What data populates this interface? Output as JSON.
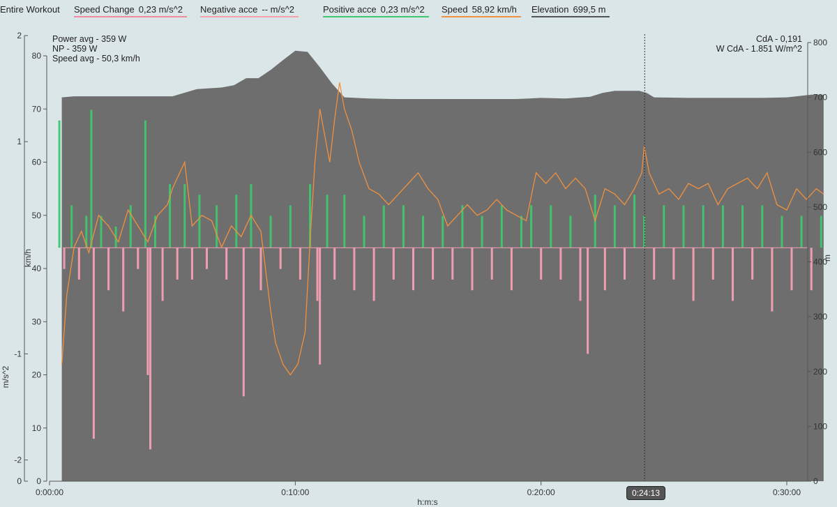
{
  "legend": {
    "scope": "Entire Workout",
    "items": [
      {
        "name": "Speed Change",
        "value": "0,23 m/s^2",
        "color": "#f08aa0"
      },
      {
        "name": "Negative acce",
        "value": "-- m/s^2",
        "color": "#f5a3a8"
      },
      {
        "name": "Positive acce",
        "value": "0,23 m/s^2",
        "color": "#3fc66e"
      },
      {
        "name": "Speed",
        "value": "58,92 km/h",
        "color": "#f0913f"
      },
      {
        "name": "Elevation",
        "value": "699,5 m",
        "color": "#555555"
      }
    ]
  },
  "info_left": [
    "Power avg - 359 W",
    "NP - 359 W",
    "Speed avg - 50,3 km/h"
  ],
  "info_right": [
    "CdA - 0,191",
    "W CdA - 1.851 W/m^2"
  ],
  "cursor_time": "0:24:13",
  "colors": {
    "background": "#dbe6e8",
    "elevation": "#6e6e6e",
    "speed": "#f0913f",
    "positive": "#3fc66e",
    "negative": "#f5a0b4"
  },
  "chart_data": {
    "type": "area",
    "xlabel": "h:m:s",
    "x_range_min": [
      0,
      31.5
    ],
    "x_ticks": [
      {
        "v": 0,
        "label": "0:00:00"
      },
      {
        "v": 10,
        "label": "0:10:00"
      },
      {
        "v": 20,
        "label": "0:20:00"
      },
      {
        "v": 30,
        "label": "0:30:00"
      }
    ],
    "axes": {
      "accel": {
        "label": "m/s^2",
        "range": [
          -2.2,
          2.0
        ],
        "ticks": [
          {
            "v": 2,
            "label": "2"
          },
          {
            "v": 1,
            "label": "1"
          },
          {
            "v": -1,
            "label": "-1"
          },
          {
            "v": -2,
            "label": "-2"
          },
          {
            "v": -2.2,
            "label": "0"
          }
        ]
      },
      "speed": {
        "label": "km/h",
        "range": [
          0,
          80
        ],
        "ticks": [
          0,
          10,
          20,
          30,
          40,
          50,
          60,
          70,
          80
        ]
      },
      "elevation": {
        "label": "m",
        "range": [
          0,
          800
        ],
        "ticks": [
          0,
          100,
          200,
          300,
          400,
          500,
          600,
          700,
          800
        ]
      }
    },
    "series": [
      {
        "name": "Elevation",
        "unit": "m",
        "points": [
          [
            0.5,
            700
          ],
          [
            1,
            702
          ],
          [
            2,
            702
          ],
          [
            3,
            702
          ],
          [
            4,
            702
          ],
          [
            5,
            702
          ],
          [
            6,
            715
          ],
          [
            7,
            718
          ],
          [
            7.5,
            722
          ],
          [
            8,
            735
          ],
          [
            8.5,
            735
          ],
          [
            9,
            750
          ],
          [
            9.5,
            768
          ],
          [
            10,
            785
          ],
          [
            10.5,
            783
          ],
          [
            11,
            755
          ],
          [
            11.5,
            725
          ],
          [
            12,
            700
          ],
          [
            13,
            698
          ],
          [
            14,
            697
          ],
          [
            15,
            697
          ],
          [
            16,
            697
          ],
          [
            17,
            697
          ],
          [
            18,
            697
          ],
          [
            19,
            697
          ],
          [
            19.5,
            698
          ],
          [
            20,
            699
          ],
          [
            21,
            698
          ],
          [
            22,
            701
          ],
          [
            22.5,
            708
          ],
          [
            23,
            712
          ],
          [
            24,
            712
          ],
          [
            24.3,
            708
          ],
          [
            24.6,
            700
          ],
          [
            26,
            699
          ],
          [
            28,
            699
          ],
          [
            29,
            699
          ],
          [
            30,
            700
          ],
          [
            31,
            705
          ],
          [
            31.5,
            705
          ]
        ]
      },
      {
        "name": "Speed",
        "unit": "km/h",
        "points": [
          [
            0.5,
            22
          ],
          [
            0.7,
            35
          ],
          [
            1,
            44
          ],
          [
            1.3,
            47
          ],
          [
            1.6,
            43
          ],
          [
            2,
            50
          ],
          [
            2.4,
            48
          ],
          [
            2.8,
            45
          ],
          [
            3.2,
            51
          ],
          [
            3.6,
            48
          ],
          [
            4,
            45
          ],
          [
            4.4,
            50
          ],
          [
            4.8,
            52
          ],
          [
            5,
            55
          ],
          [
            5.3,
            58
          ],
          [
            5.5,
            60
          ],
          [
            5.8,
            48
          ],
          [
            6.2,
            50
          ],
          [
            6.6,
            49
          ],
          [
            7,
            44
          ],
          [
            7.4,
            48
          ],
          [
            7.8,
            46
          ],
          [
            8.2,
            50
          ],
          [
            8.6,
            47
          ],
          [
            9,
            32
          ],
          [
            9.2,
            26
          ],
          [
            9.5,
            22
          ],
          [
            9.8,
            20
          ],
          [
            10.1,
            22
          ],
          [
            10.4,
            28
          ],
          [
            10.6,
            45
          ],
          [
            10.8,
            60
          ],
          [
            11,
            70
          ],
          [
            11.2,
            65
          ],
          [
            11.4,
            60
          ],
          [
            11.6,
            68
          ],
          [
            11.8,
            75
          ],
          [
            12,
            70
          ],
          [
            12.3,
            66
          ],
          [
            12.6,
            60
          ],
          [
            13,
            55
          ],
          [
            13.4,
            54
          ],
          [
            13.8,
            52
          ],
          [
            14.2,
            54
          ],
          [
            14.6,
            56
          ],
          [
            15,
            58
          ],
          [
            15.4,
            55
          ],
          [
            15.8,
            53
          ],
          [
            16.2,
            48
          ],
          [
            16.6,
            50
          ],
          [
            17,
            52
          ],
          [
            17.4,
            50
          ],
          [
            17.8,
            51
          ],
          [
            18.2,
            53
          ],
          [
            18.6,
            51
          ],
          [
            19,
            50
          ],
          [
            19.4,
            49
          ],
          [
            19.8,
            58
          ],
          [
            20.2,
            56
          ],
          [
            20.6,
            58
          ],
          [
            21,
            55
          ],
          [
            21.4,
            57
          ],
          [
            21.8,
            55
          ],
          [
            22.2,
            49
          ],
          [
            22.6,
            55
          ],
          [
            23,
            54
          ],
          [
            23.4,
            52
          ],
          [
            23.8,
            55
          ],
          [
            24.1,
            58
          ],
          [
            24.2,
            63
          ],
          [
            24.4,
            58
          ],
          [
            24.8,
            54
          ],
          [
            25.2,
            55
          ],
          [
            25.6,
            53
          ],
          [
            26,
            56
          ],
          [
            26.4,
            55
          ],
          [
            26.8,
            56
          ],
          [
            27.2,
            52
          ],
          [
            27.6,
            55
          ],
          [
            28,
            56
          ],
          [
            28.4,
            57
          ],
          [
            28.8,
            55
          ],
          [
            29.2,
            58
          ],
          [
            29.6,
            52
          ],
          [
            30,
            51
          ],
          [
            30.4,
            55
          ],
          [
            30.8,
            53
          ],
          [
            31.2,
            55
          ],
          [
            31.5,
            54
          ]
        ]
      },
      {
        "name": "Speed Change",
        "unit": "m/s^2",
        "points": [
          [
            0.4,
            1.2
          ],
          [
            0.6,
            -0.2
          ],
          [
            0.9,
            0.4
          ],
          [
            1.2,
            -0.3
          ],
          [
            1.5,
            0.3
          ],
          [
            1.7,
            1.3
          ],
          [
            1.8,
            -1.8
          ],
          [
            2.1,
            0.3
          ],
          [
            2.4,
            -0.4
          ],
          [
            2.7,
            0.2
          ],
          [
            3.0,
            -0.6
          ],
          [
            3.3,
            0.4
          ],
          [
            3.6,
            -0.2
          ],
          [
            3.9,
            1.2
          ],
          [
            4.0,
            -1.2
          ],
          [
            4.1,
            -1.9
          ],
          [
            4.3,
            0.3
          ],
          [
            4.6,
            -0.5
          ],
          [
            4.9,
            0.6
          ],
          [
            5.2,
            -0.3
          ],
          [
            5.5,
            0.6
          ],
          [
            5.8,
            -0.3
          ],
          [
            6.1,
            0.5
          ],
          [
            6.4,
            -0.2
          ],
          [
            6.8,
            0.4
          ],
          [
            7.2,
            -0.3
          ],
          [
            7.6,
            0.5
          ],
          [
            7.9,
            -1.4
          ],
          [
            8.2,
            0.6
          ],
          [
            8.6,
            -0.4
          ],
          [
            9.0,
            0.3
          ],
          [
            9.4,
            -0.2
          ],
          [
            9.8,
            0.4
          ],
          [
            10.2,
            -0.3
          ],
          [
            10.6,
            0.6
          ],
          [
            10.9,
            -0.5
          ],
          [
            11.0,
            -1.1
          ],
          [
            11.3,
            0.5
          ],
          [
            11.6,
            -0.3
          ],
          [
            12.0,
            0.5
          ],
          [
            12.4,
            -0.4
          ],
          [
            12.8,
            0.3
          ],
          [
            13.2,
            -0.5
          ],
          [
            13.6,
            0.4
          ],
          [
            14.0,
            -0.3
          ],
          [
            14.4,
            0.4
          ],
          [
            14.8,
            -0.4
          ],
          [
            15.2,
            0.3
          ],
          [
            15.6,
            -0.3
          ],
          [
            16.0,
            0.3
          ],
          [
            16.4,
            -0.3
          ],
          [
            16.8,
            0.4
          ],
          [
            17.2,
            -0.4
          ],
          [
            17.6,
            0.3
          ],
          [
            18.0,
            -0.3
          ],
          [
            18.4,
            0.4
          ],
          [
            18.8,
            -0.4
          ],
          [
            19.2,
            0.3
          ],
          [
            19.6,
            0.4
          ],
          [
            20.0,
            -0.3
          ],
          [
            20.4,
            0.4
          ],
          [
            20.8,
            -0.3
          ],
          [
            21.2,
            0.3
          ],
          [
            21.6,
            -0.5
          ],
          [
            21.9,
            -1.0
          ],
          [
            22.2,
            0.5
          ],
          [
            22.6,
            -0.4
          ],
          [
            23.0,
            0.4
          ],
          [
            23.4,
            -0.3
          ],
          [
            23.8,
            0.5
          ],
          [
            24.2,
            0.3
          ],
          [
            24.6,
            -0.3
          ],
          [
            25.0,
            0.4
          ],
          [
            25.4,
            -0.3
          ],
          [
            25.8,
            0.4
          ],
          [
            26.2,
            -0.5
          ],
          [
            26.6,
            0.4
          ],
          [
            27.0,
            -0.3
          ],
          [
            27.4,
            0.4
          ],
          [
            27.8,
            -0.5
          ],
          [
            28.2,
            0.4
          ],
          [
            28.6,
            -0.3
          ],
          [
            29.0,
            0.4
          ],
          [
            29.4,
            -0.6
          ],
          [
            29.8,
            0.3
          ],
          [
            30.2,
            -0.4
          ],
          [
            30.6,
            0.3
          ],
          [
            31.0,
            -0.4
          ],
          [
            31.4,
            0.3
          ]
        ]
      }
    ],
    "cursor_x": 24.22
  }
}
